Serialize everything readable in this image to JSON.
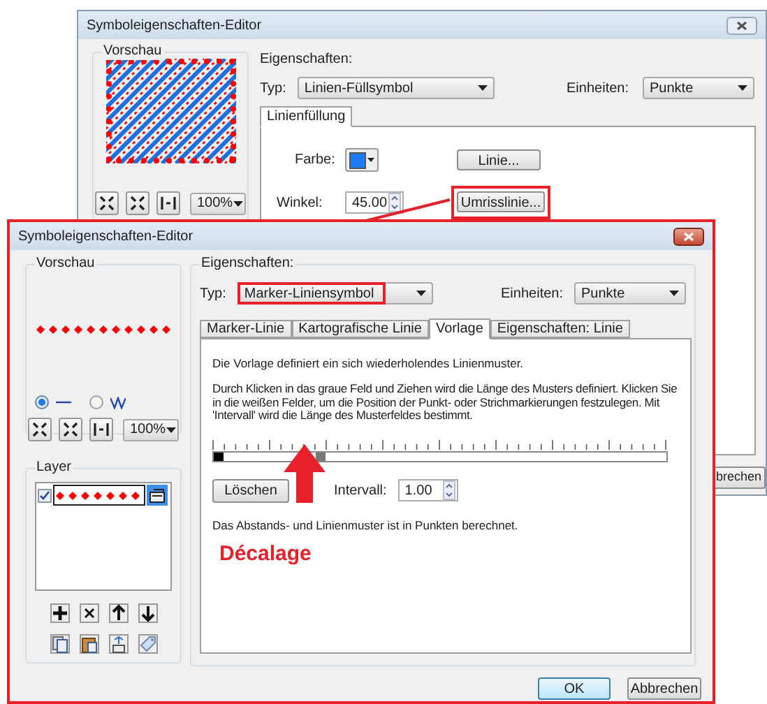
{
  "back_window": {
    "title": "Symboleigenschaften-Editor",
    "preview_label": "Vorschau",
    "zoom_level": "100%",
    "properties_label": "Eigenschaften:",
    "type_label": "Typ:",
    "type_value": "Linien-Füllsymbol",
    "units_label": "Einheiten:",
    "units_value": "Punkte",
    "tabs": [
      {
        "label": "Linienfüllung",
        "selected": true
      }
    ],
    "color_label": "Farbe:",
    "line_button": "Linie...",
    "angle_label": "Winkel:",
    "angle_value": "45.00",
    "outline_button": "Umrisslinie...",
    "outline_highlighted": true,
    "cancel_button": "brechen"
  },
  "front_window": {
    "title": "Symboleigenschaften-Editor",
    "preview_label": "Vorschau",
    "preview_modes": [
      {
        "kind": "straight",
        "selected": true
      },
      {
        "kind": "zigzag",
        "selected": false
      }
    ],
    "zoom_level": "100%",
    "layer_label": "Layer",
    "layers": [
      {
        "checked": true
      }
    ],
    "properties_label": "Eigenschaften:",
    "type_label": "Typ:",
    "type_value": "Marker-Liniensymbol",
    "type_highlighted": true,
    "units_label": "Einheiten:",
    "units_value": "Punkte",
    "tabs": [
      {
        "label": "Marker-Linie",
        "selected": false
      },
      {
        "label": "Kartografische Linie",
        "selected": false
      },
      {
        "label": "Vorlage",
        "selected": true
      },
      {
        "label": "Eigenschaften: Linie",
        "selected": false
      }
    ],
    "description": "Die Vorlage definiert ein sich wiederholendes Linienmuster.",
    "instructions": "Durch Klicken in das graue Feld und Ziehen wird die Länge des Musters definiert. Klicken Sie in die weißen Felder, um die Position der Punkt- oder Strichmarkierungen festzulegen. Mit 'Intervall' wird die Länge des Musterfeldes bestimmt.",
    "delete_button": "Löschen",
    "interval_label": "Intervall:",
    "interval_value": "1.00",
    "footnote": "Das Abstands- und Linienmuster ist in Punkten berechnet.",
    "ok_button": "OK",
    "cancel_button": "Abbrechen"
  },
  "annotation": {
    "label": "Décalage"
  }
}
